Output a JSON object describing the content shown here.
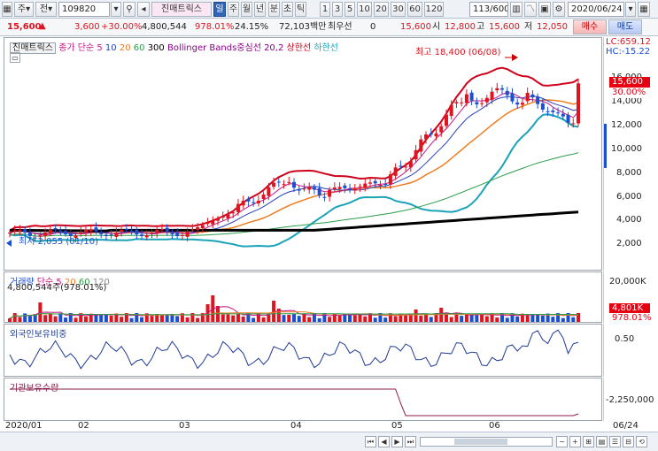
{
  "toolbar": {
    "mode_btn": "주",
    "side_btn": "전",
    "code": "109820",
    "name": "진매트릭스",
    "period_active": "일",
    "periods": [
      "주",
      "월",
      "년",
      "분",
      "초",
      "틱"
    ],
    "nums": [
      "1",
      "3",
      "5",
      "10",
      "20",
      "30",
      "60",
      "120"
    ],
    "count": "113/600",
    "date": "2020/06/24",
    "buy": "매수",
    "sell": "매도"
  },
  "quote": {
    "price": "15,600",
    "change": "3,600",
    "change_pct": "+30.00%",
    "volume": "4,800,544",
    "vol_ratio": "978.01%",
    "turnover": "24.15%",
    "amount": "72,103백만",
    "priority_label": "최우선",
    "priority_val": "0",
    "last": "15,600",
    "open_label": "시",
    "open": "12,800",
    "high_label": "고",
    "high": "15,600",
    "low_label": "저",
    "low": "12,050"
  },
  "price_pane": {
    "stock": "진매트릭스",
    "ma_label": "종가 단순",
    "ma_periods": [
      "5",
      "10",
      "20",
      "60",
      "300"
    ],
    "bb_label": "Bollinger Bands중심선 20,2",
    "bb_upper": "상한선",
    "bb_lower": "하한선",
    "lc": "LC:659.12",
    "hc": "HC:-15.22",
    "max_note": "최고 18,400 (06/08)",
    "min_note": "최저 2,055 (01/10)",
    "axis": [
      "16,000",
      "14,000",
      "12,000",
      "10,000",
      "8,000",
      "6,000",
      "4,000",
      "2,000"
    ],
    "last_badge": "15,600",
    "pct_badge": "30.00%"
  },
  "volume_pane": {
    "label": "거래량",
    "ma_label": "단순",
    "ma_periods": [
      "5",
      "20",
      "60",
      "120"
    ],
    "value": "4,800,544주(978.01%)",
    "axis": "20,000K",
    "badge": "4,801K",
    "badge_pct": "978.01%"
  },
  "foreign_pane": {
    "label": "외국인보유비중",
    "axis": "0.50"
  },
  "inst_pane": {
    "label": "기관보유수량",
    "axis": "-2,250,000"
  },
  "x_axis": [
    "2020/01",
    "02",
    "03",
    "04",
    "05",
    "06",
    "06/24"
  ],
  "colors": {
    "up": "#e0141e",
    "down": "#1b4fd1",
    "bb": "#d0021b",
    "lower": "#1aa3b8",
    "ma300": "#000000"
  }
}
